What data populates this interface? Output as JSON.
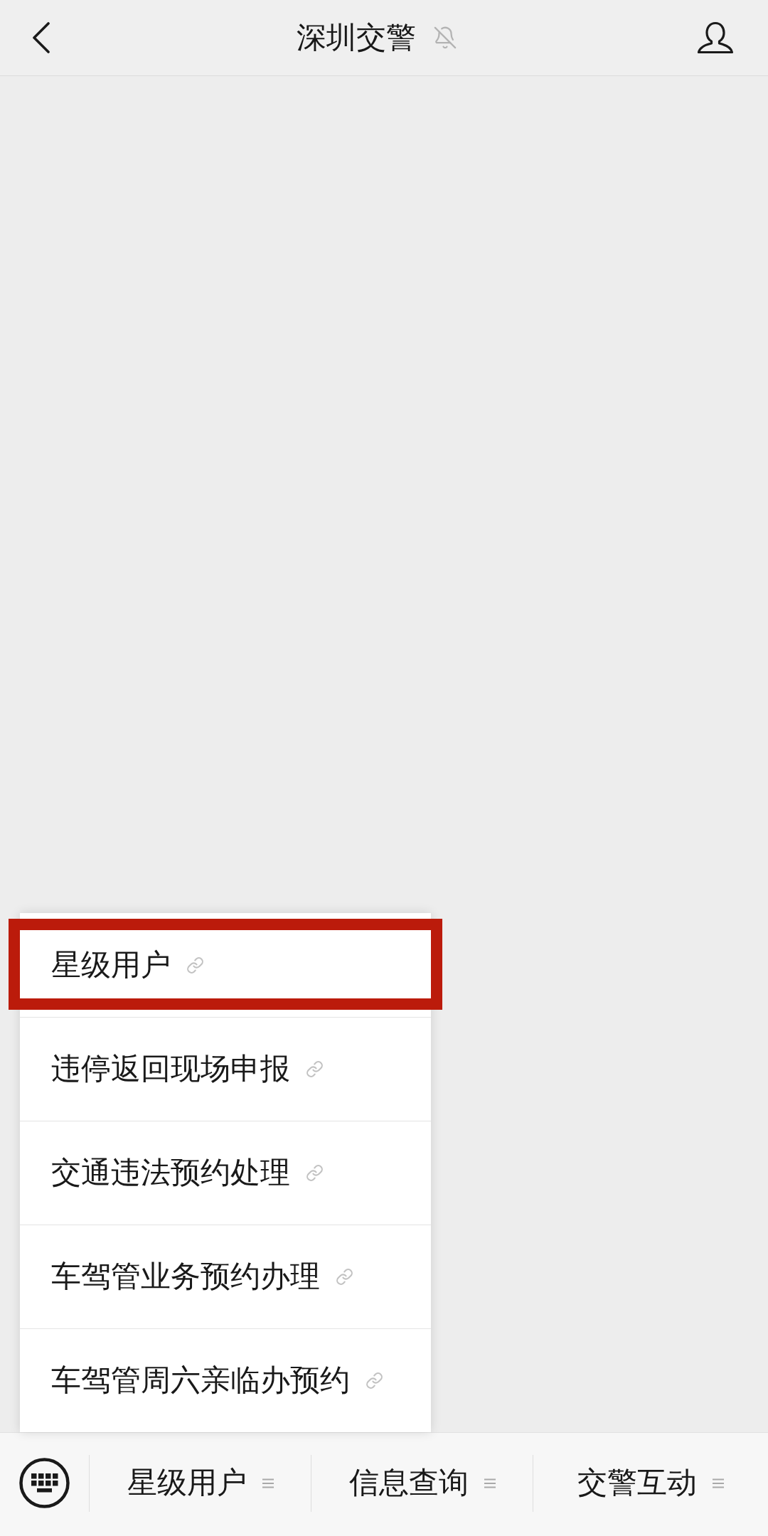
{
  "header": {
    "title": "深圳交警",
    "muted": true
  },
  "menu": {
    "items": [
      {
        "label": "星级用户",
        "highlighted": true
      },
      {
        "label": "违停返回现场申报",
        "highlighted": false
      },
      {
        "label": "交通违法预约处理",
        "highlighted": false
      },
      {
        "label": "车驾管业务预约办理",
        "highlighted": false
      },
      {
        "label": "车驾管周六亲临办预约",
        "highlighted": false
      }
    ]
  },
  "bottom_bar": {
    "tabs": [
      {
        "label": "星级用户"
      },
      {
        "label": "信息查询"
      },
      {
        "label": "交警互动"
      }
    ]
  }
}
